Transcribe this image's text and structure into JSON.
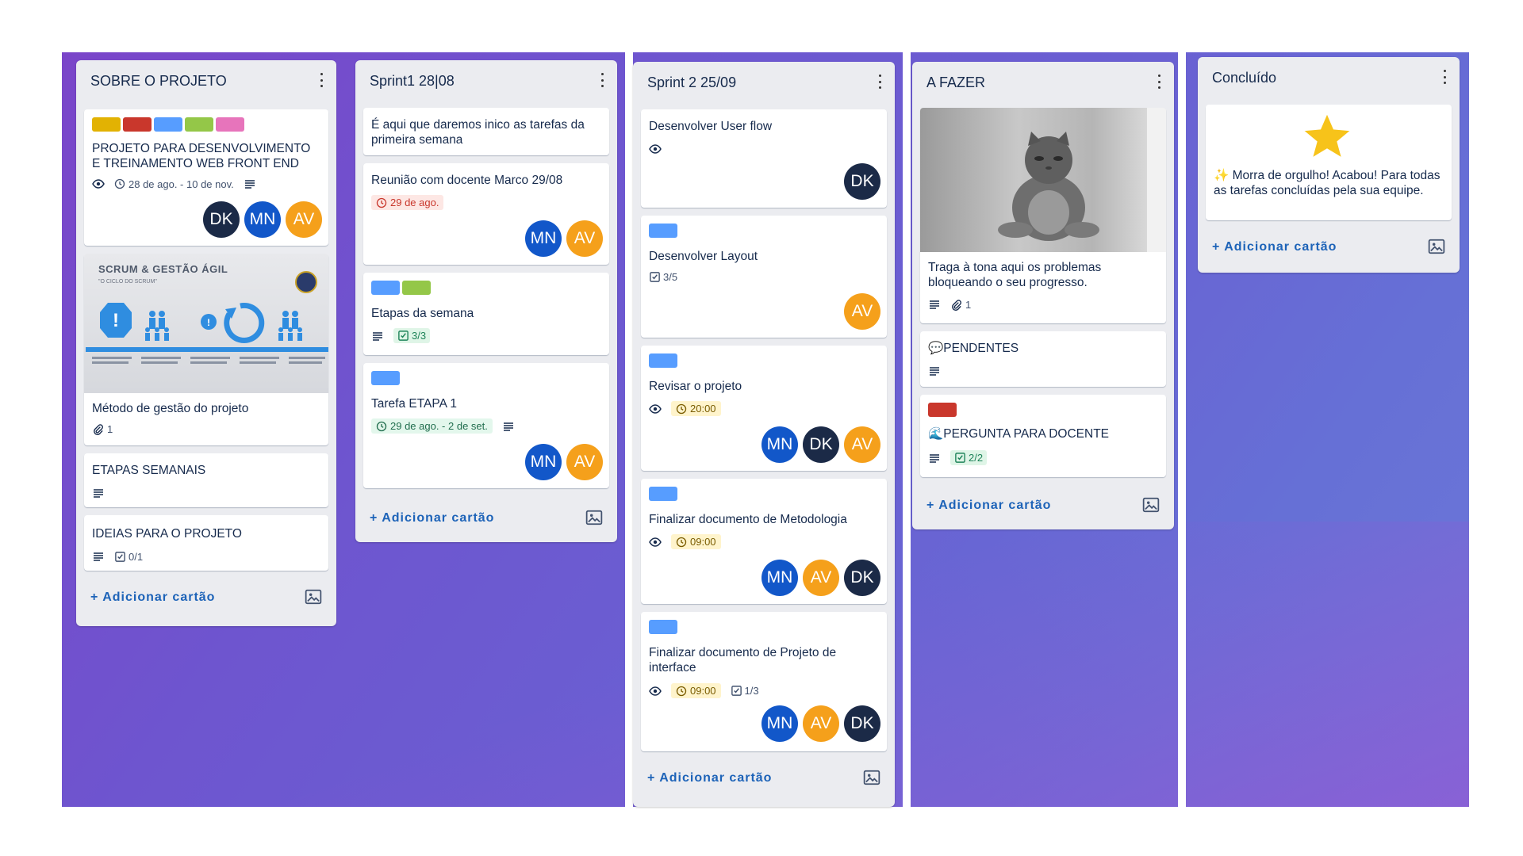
{
  "lists": [
    {
      "title": "SOBRE O PROJETO",
      "cards": [
        {
          "labels": [
            "#e2b203",
            "#c9372c",
            "#579dff",
            "#94c748",
            "#e774bb"
          ],
          "title": "PROJETO PARA DESENVOLVIMENTO E TREINAMENTO WEB FRONT END",
          "dates": "28 de ago. - 10 de nov.",
          "members": [
            "DK",
            "MN",
            "AV"
          ]
        },
        {
          "cover": {
            "heading": "SCRUM & GESTÃO ÁGIL",
            "subheading": "\"O CICLO DO SCRUM\"",
            "columns": [
              "BACKLOG",
              "SCRUM",
              "SPRINT PLAN",
              "SPRINT",
              "SCRUM"
            ]
          },
          "title": "Método de gestão do projeto",
          "attachments": "1"
        },
        {
          "title": "ETAPAS SEMANAIS"
        },
        {
          "title": "IDEIAS PARA O PROJETO",
          "checklist": "0/1"
        }
      ],
      "add_label": "+ Adicionar cartão"
    },
    {
      "title": "Sprint1 28|08",
      "cards": [
        {
          "title": "É aqui que daremos inico as tarefas da primeira semana"
        },
        {
          "title": "Reunião com docente Marco 29/08",
          "due": "29 de ago.",
          "members": [
            "MN",
            "AV"
          ]
        },
        {
          "labels": [
            "#579dff",
            "#94c748"
          ],
          "title": "Etapas da semana",
          "checklist": "3/3"
        },
        {
          "labels": [
            "#579dff"
          ],
          "title": "Tarefa ETAPA 1",
          "due": "29 de ago. - 2 de set.",
          "members": [
            "MN",
            "AV"
          ]
        }
      ],
      "add_label": "+ Adicionar cartão"
    },
    {
      "title": "Sprint 2 25/09",
      "cards": [
        {
          "title": "Desenvolver User flow",
          "members": [
            "DK"
          ]
        },
        {
          "labels": [
            "#579dff"
          ],
          "title": "Desenvolver Layout",
          "checklist": "3/5",
          "members": [
            "AV"
          ]
        },
        {
          "labels": [
            "#579dff"
          ],
          "title": "Revisar o projeto",
          "due": "20:00",
          "members": [
            "MN",
            "DK",
            "AV"
          ]
        },
        {
          "labels": [
            "#579dff"
          ],
          "title": "Finalizar documento de Metodologia",
          "due": "09:00",
          "members": [
            "MN",
            "AV",
            "DK"
          ]
        },
        {
          "labels": [
            "#579dff"
          ],
          "title": "Finalizar documento de Projeto de interface",
          "due": "09:00",
          "checklist": "1/3",
          "members": [
            "MN",
            "AV",
            "DK"
          ]
        }
      ],
      "add_label": "+ Adicionar cartão"
    },
    {
      "title": "A FAZER",
      "cards": [
        {
          "title": "Traga à tona aqui os problemas bloqueando o seu progresso.",
          "attachments": "1"
        },
        {
          "title": "💬PENDENTES"
        },
        {
          "labels": [
            "#c9372c"
          ],
          "title": "🌊PERGUNTA PARA DOCENTE",
          "checklist": "2/2"
        }
      ],
      "add_label": "+ Adicionar cartão"
    },
    {
      "title": "Concluído",
      "cards": [
        {
          "title": "✨ Morra de orgulho! Acabou! Para todas as tarefas concluídas pela sua equipe."
        }
      ],
      "add_label": "+ Adicionar cartão"
    }
  ],
  "icons": {
    "watch": "eye-icon",
    "clock": "clock-icon",
    "description": "description-icon",
    "checklist": "checklist-icon",
    "attachment": "paperclip-icon",
    "template": "image-template-icon",
    "menu": "three-dots-icon",
    "star": "star-icon"
  },
  "colors": {
    "avatar_dk": "#1b2a47",
    "avatar_mn": "#1257c9",
    "avatar_av": "#f5a01b",
    "add_link": "#1d63b8"
  }
}
